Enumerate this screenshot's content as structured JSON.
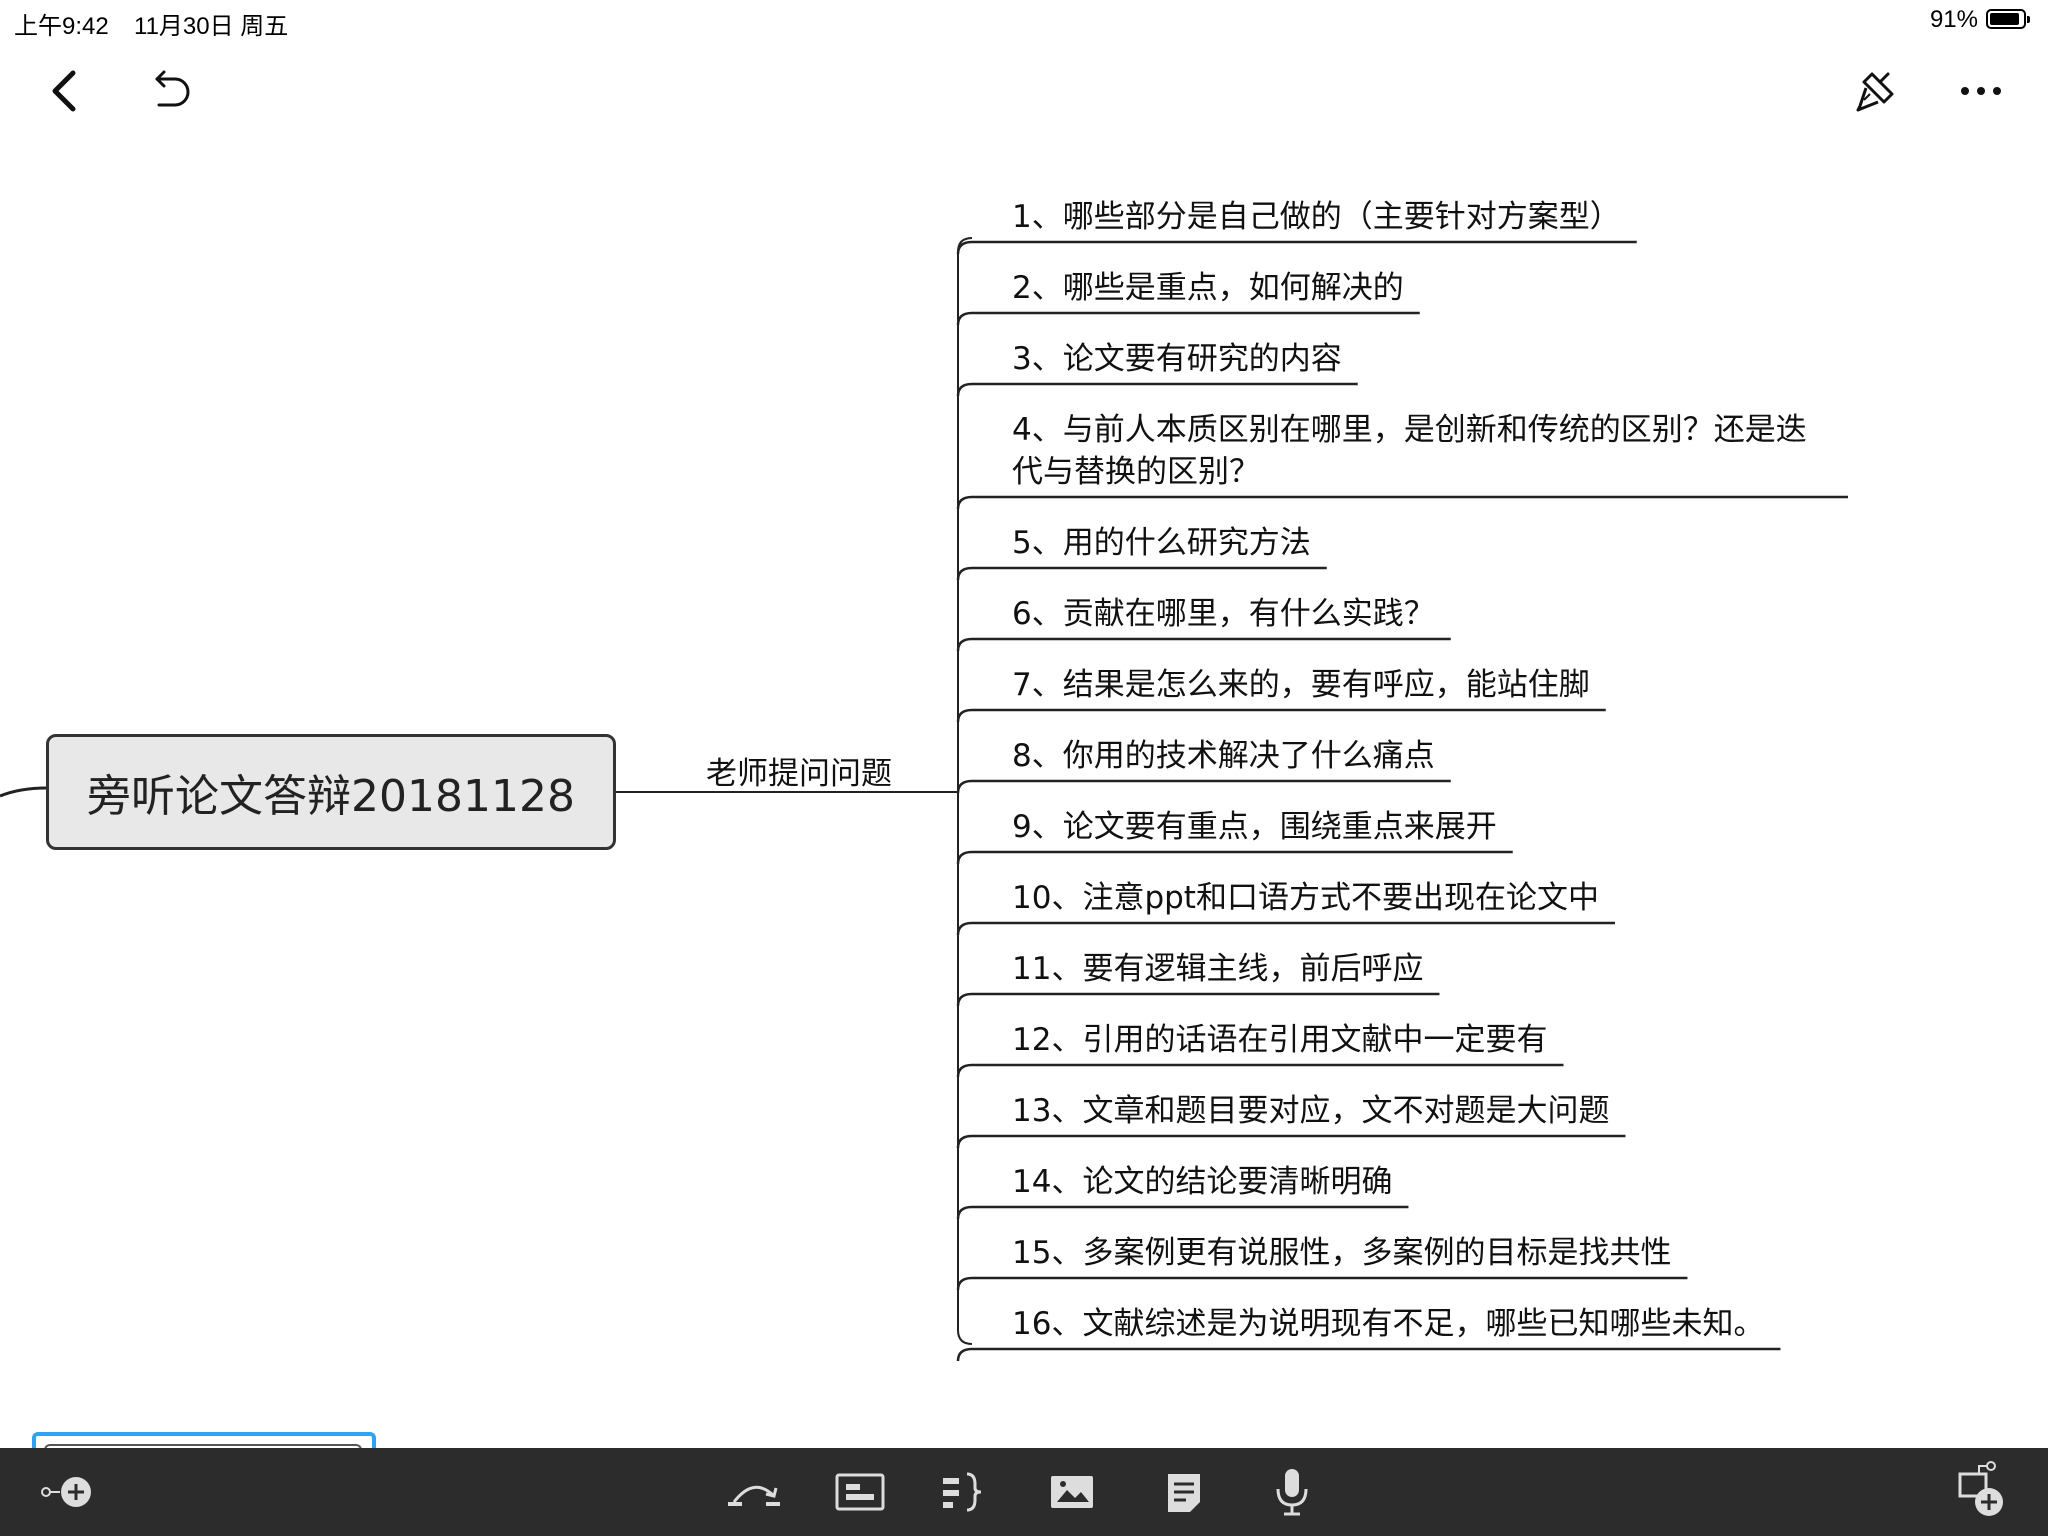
{
  "status_bar": {
    "time": "上午9:42",
    "date": "11月30日 周五",
    "battery_percent": "91%",
    "battery_level": 0.91
  },
  "toolbar_top": {
    "back_icon": "chevron-left-icon",
    "undo_icon": "undo-icon",
    "format_icon": "paint-brush-icon",
    "more_icon": "more-horizontal-icon"
  },
  "mindmap": {
    "root": "旁听论文答辩20181128",
    "branch": "老师提问问题",
    "items": [
      "1、哪些部分是自己做的（主要针对方案型）",
      "2、哪些是重点，如何解决的",
      "3、论文要有研究的内容",
      "4、与前人本质区别在哪里，是创新和传统的区别？还是迭代与替换的区别？",
      "5、用的什么研究方法",
      "6、贡献在哪里，有什么实践？",
      "7、结果是怎么来的，要有呼应，能站住脚",
      "8、你用的技术解决了什么痛点",
      "9、论文要有重点，围绕重点来展开",
      "10、注意ppt和口语方式不要出现在论文中",
      "11、要有逻辑主线，前后呼应",
      "12、引用的话语在引用文献中一定要有",
      "13、文章和题目要对应，文不对题是大问题",
      "14、论文的结论要清晰明确",
      "15、多案例更有说服性，多案例的目标是找共性",
      "16、文献综述是为说明现有不足，哪些已知哪些未知。"
    ],
    "line_color": "#222222",
    "root_fill": "#e8e8e8"
  },
  "bottom_toolbar": {
    "icons": [
      "add-topic-icon",
      "relationship-icon",
      "boundary-icon",
      "summary-icon",
      "image-icon",
      "note-icon",
      "audio-icon",
      "add-floating-topic-icon"
    ],
    "background": "#2c2c2c",
    "selection_color": "#2ea3f2"
  }
}
